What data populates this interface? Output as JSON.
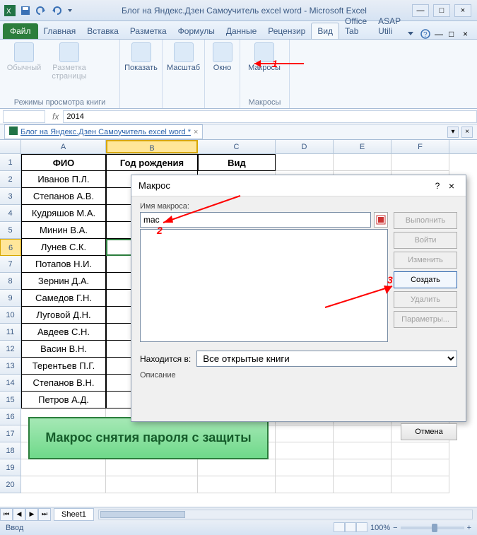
{
  "title": "Блог на Яндекс.Дзен Самоучитель excel word  -  Microsoft Excel",
  "ribbon_tabs": {
    "file": "Файл",
    "items": [
      "Главная",
      "Вставка",
      "Разметка",
      "Формулы",
      "Данные",
      "Рецензир",
      "Вид",
      "Office Tab",
      "ASAP Utili"
    ],
    "active_index": 6
  },
  "ribbon_groups": {
    "normal": "Обычный",
    "page_layout": "Разметка страницы",
    "view_modes_label": "Режимы просмотра книги",
    "show": "Показать",
    "zoom": "Масштаб",
    "window": "Окно",
    "macros": "Макросы",
    "macros_label": "Макросы"
  },
  "formula_bar": {
    "name_box": "",
    "fx": "fx",
    "value": "2014"
  },
  "doc_tab": {
    "name": "Блог на Яндекс.Дзен Самоучитель excel word *",
    "close": "×"
  },
  "columns": [
    "A",
    "B",
    "C",
    "D",
    "E",
    "F"
  ],
  "headers": {
    "A": "ФИО",
    "B": "Год рождения",
    "C": "Вид"
  },
  "rows": [
    "Иванов П.Л.",
    "Степанов А.В.",
    "Кудряшов М.А.",
    "Минин В.А.",
    "Лунев С.К.",
    "Потапов Н.И.",
    "Зернин Д.А.",
    "Самедов Г.Н.",
    "Луговой Д.Н.",
    "Авдеев С.Н.",
    "Васин В.Н.",
    "Терентьев П.Г.",
    "Степанов В.Н.",
    "Петров А.Д."
  ],
  "banner": "Макрос снятия пароля с защиты",
  "macro_dialog": {
    "title": "Макрос",
    "help": "?",
    "close": "×",
    "name_label": "Имя макроса:",
    "name_value": "mac",
    "buttons": {
      "run": "Выполнить",
      "step": "Войти",
      "edit": "Изменить",
      "create": "Создать",
      "delete": "Удалить",
      "options": "Параметры..."
    },
    "location_label": "Находится в:",
    "location_value": "Все открытые книги",
    "description_label": "Описание",
    "cancel": "Отмена"
  },
  "annotations": {
    "n1": "1",
    "n2": "2",
    "n3": "3"
  },
  "sheet": {
    "name": "Sheet1"
  },
  "status": {
    "mode": "Ввод",
    "zoom": "100%"
  }
}
